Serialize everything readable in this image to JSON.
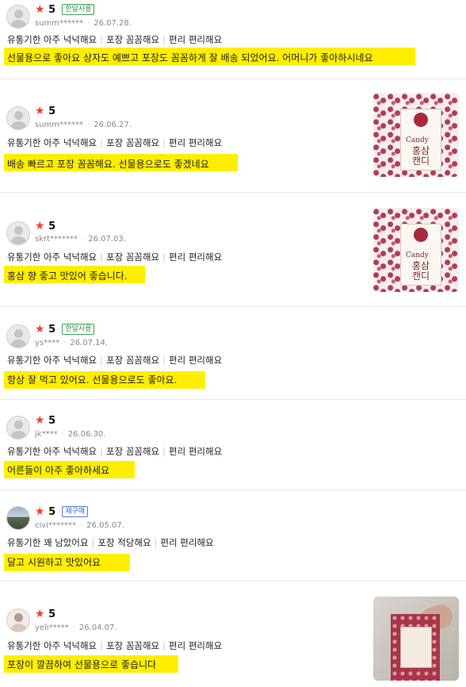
{
  "reviews": [
    {
      "rating": "5",
      "badge": "한달사용",
      "badge_style": "green",
      "user": "summ******",
      "date": "26.07.28.",
      "tag1": "유통기한 아주 넉넉해요",
      "tag2": "포장 꼼꼼해요",
      "tag3": "편리 편리해요",
      "text": "선물용으로 좋아요 상자도 예쁘고 포장도 꼼꼼하게 잘 배송 되었어요. 어머니가 좋아하시네요"
    },
    {
      "rating": "5",
      "badge": "",
      "user": "summ******",
      "date": "26.06.27.",
      "tag1": "유통기한 아주 넉넉해요",
      "tag2": "포장 꼼꼼해요",
      "tag3": "편리 편리해요",
      "text": "배송 빠르고 포장 꼼꼼해요. 선물용으로도 좋겠네요",
      "thumb": {
        "en": "Candy",
        "kr": "홍삼 캔디"
      }
    },
    {
      "rating": "5",
      "badge": "",
      "user": "skrt*******",
      "date": "26.07.03.",
      "tag1": "유통기한 아주 넉넉해요",
      "tag2": "포장 꼼꼼해요",
      "tag3": "편리 편리해요",
      "text": "홍삼 향 좋고 맛있어 좋습니다.",
      "thumb": {
        "en": "Candy",
        "kr": "홍삼 캔디"
      }
    },
    {
      "rating": "5",
      "badge": "한달사용",
      "badge_style": "green",
      "user": "ys****",
      "date": "26.07.14.",
      "tag1": "유통기한 아주 넉넉해요",
      "tag2": "포장 꼼꼼해요",
      "tag3": "편리 편리해요",
      "text": "항상 잘 먹고 있어요. 선물용으로도 좋아요."
    },
    {
      "rating": "5",
      "badge": "",
      "user": "jk****",
      "date": "26.06.30.",
      "tag1": "유통기한 아주 넉넉해요",
      "tag2": "포장 꼼꼼해요",
      "tag3": "편리 편리해요",
      "text": "어른들이 아주 좋아하세요"
    },
    {
      "rating": "5",
      "badge": "재구매",
      "badge_style": "blue",
      "user": "civi*******",
      "date": "26.05.07.",
      "tag1": "유통기한 꽤 남았어요",
      "tag2": "포장 적당해요",
      "tag3": "편리 편리해요",
      "text": "달고 시원하고 맛있어요"
    },
    {
      "rating": "5",
      "badge": "",
      "user": "yeli*****",
      "date": "26.04.07.",
      "tag1": "유통기한 아주 넉넉해요",
      "tag2": "포장 꼼꼼해요",
      "tag3": "편리 편리해요",
      "text": "포장이 깔끔하여 선물용으로 좋습니다"
    }
  ],
  "colors": {
    "star": "#f0412b",
    "highlight": "#ffee00",
    "badge_green": "#2f8f46",
    "badge_blue": "#3566b8"
  },
  "icons": {
    "star": "star-icon",
    "avatar": "default-avatar-icon"
  }
}
